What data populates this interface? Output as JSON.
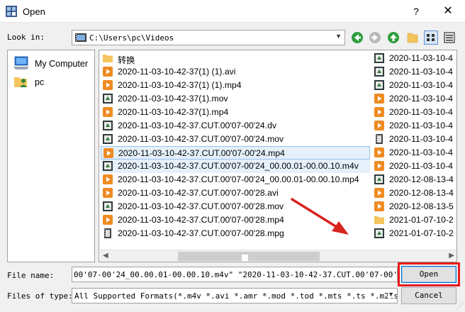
{
  "window": {
    "title": "Open",
    "help": "?",
    "close": "✕"
  },
  "lookin": {
    "label": "Look in:",
    "value": "C:\\Users\\pc\\Videos"
  },
  "toolbar": {
    "icons": [
      "back-icon",
      "forward-icon",
      "up-icon",
      "new-folder-icon",
      "list-view-icon",
      "detail-view-icon"
    ]
  },
  "places": [
    {
      "label": "My Computer",
      "icon": "computer-icon"
    },
    {
      "label": "pc",
      "icon": "user-folder-icon"
    }
  ],
  "files": {
    "col1": [
      {
        "name": "转换",
        "type": "folder"
      },
      {
        "name": "2020-11-03-10-42-37(1) (1).avi",
        "type": "video"
      },
      {
        "name": "2020-11-03-10-42-37(1) (1).mp4",
        "type": "video"
      },
      {
        "name": "2020-11-03-10-42-37(1).mov",
        "type": "mov"
      },
      {
        "name": "2020-11-03-10-42-37(1).mp4",
        "type": "video"
      },
      {
        "name": "2020-11-03-10-42-37.CUT.00'07-00'24.dv",
        "type": "mov"
      },
      {
        "name": "2020-11-03-10-42-37.CUT.00'07-00'24.mov",
        "type": "mov"
      },
      {
        "name": "2020-11-03-10-42-37.CUT.00'07-00'24.mp4",
        "type": "video",
        "selected": true
      },
      {
        "name": "2020-11-03-10-42-37.CUT.00'07-00'24_00.00.01-00.00.10.m4v",
        "type": "mov",
        "selected": true
      },
      {
        "name": "2020-11-03-10-42-37.CUT.00'07-00'24_00.00.01-00.00.10.mp4",
        "type": "video"
      },
      {
        "name": "2020-11-03-10-42-37.CUT.00'07-00'28.avi",
        "type": "video"
      },
      {
        "name": "2020-11-03-10-42-37.CUT.00'07-00'28.mov",
        "type": "mov"
      },
      {
        "name": "2020-11-03-10-42-37.CUT.00'07-00'28.mp4",
        "type": "video"
      },
      {
        "name": "2020-11-03-10-42-37.CUT.00'07-00'28.mpg",
        "type": "mpg"
      }
    ],
    "col2": [
      {
        "name": "2020-11-03-10-4",
        "type": "mov"
      },
      {
        "name": "2020-11-03-10-4",
        "type": "mov"
      },
      {
        "name": "2020-11-03-10-4",
        "type": "mov"
      },
      {
        "name": "2020-11-03-10-4",
        "type": "video"
      },
      {
        "name": "2020-11-03-10-4",
        "type": "video"
      },
      {
        "name": "2020-11-03-10-4",
        "type": "video"
      },
      {
        "name": "2020-11-03-10-4",
        "type": "mpg"
      },
      {
        "name": "2020-11-03-10-4",
        "type": "video"
      },
      {
        "name": "2020-11-03-10-4",
        "type": "video"
      },
      {
        "name": "2020-12-08-13-4",
        "type": "mov"
      },
      {
        "name": "2020-12-08-13-4",
        "type": "video"
      },
      {
        "name": "2020-12-08-13-5",
        "type": "video"
      },
      {
        "name": "2021-01-07-10-2",
        "type": "folder"
      },
      {
        "name": "2021-01-07-10-2",
        "type": "mov"
      }
    ]
  },
  "filename": {
    "label": "File name:",
    "value": "00'07-00'24_00.00.01-00.00.10.m4v\" \"2020-11-03-10-42-37.CUT.00'07-00'24.mp4\""
  },
  "filetype": {
    "label": "Files of type:",
    "value": "All Supported Formats(*.m4v *.avi *.amr *.mod *.tod *.mts *.ts *.m2ts *.m"
  },
  "buttons": {
    "open": "Open",
    "cancel": "Cancel"
  },
  "colors": {
    "highlight": "#e8191a",
    "selection": "#e5f0fb",
    "accent": "#0078d7"
  }
}
